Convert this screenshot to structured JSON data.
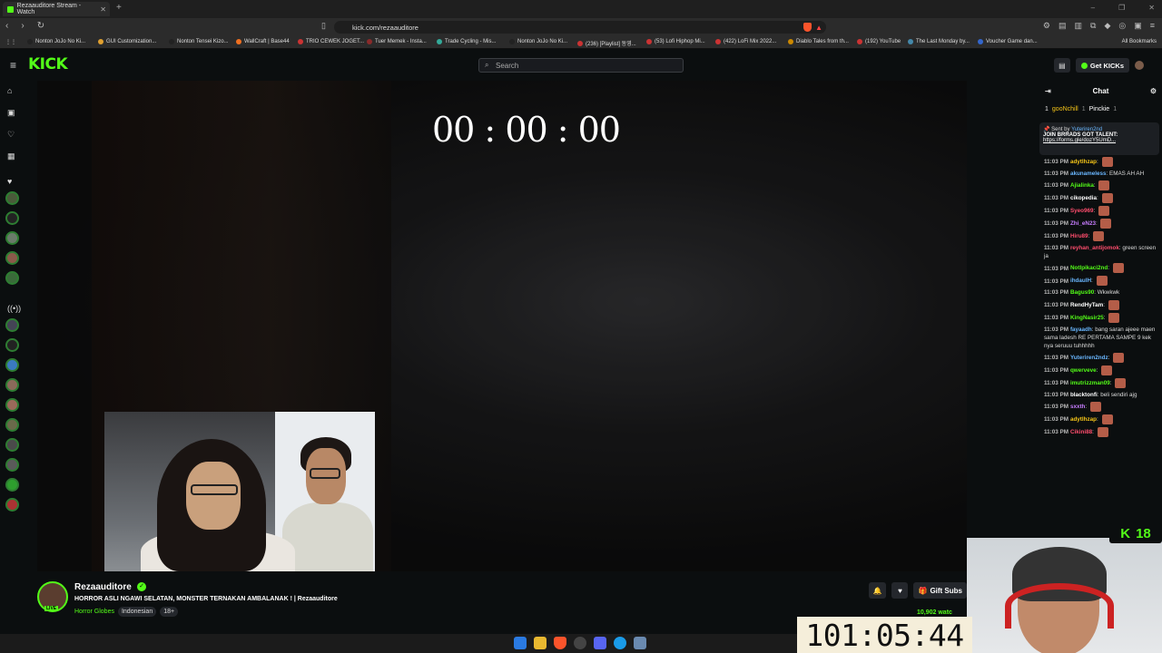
{
  "browser": {
    "tab_title": "Rezaauditore Stream - Watch",
    "url": "kick.com/rezaauditore",
    "bookmarks": [
      "Nonton JoJo No Ki...",
      "GUI Customization...",
      "Nonton Tensei Kizo...",
      "WallCraft | Base44",
      "TRIO CEWEK JOGET...",
      "Tuer Memek - Insta...",
      "Trade Cycling - Mis...",
      "Nonton JoJo No Ki...",
      "(236) [Playlist] 동영...",
      "(53) Lofi Hiphop Mi...",
      "(422) LoFi Mix 2022...",
      "Diablo Tales from th...",
      "(192) YouTube",
      "The Last Monday by...",
      "Voucher Game dan..."
    ],
    "all_bookmarks": "All Bookmarks"
  },
  "kick": {
    "logo": "KICK",
    "search_placeholder": "Search",
    "get_kicks": "Get KICKs"
  },
  "video": {
    "overlay_timer": "00 : 00 : 00"
  },
  "chat": {
    "title": "Chat",
    "leaderboard": {
      "rank": "1",
      "user1": "gooNchill",
      "user1_count": "1",
      "user2": "Pinckie",
      "user2_count": "1"
    },
    "pinned": {
      "sent_by": "Sent by",
      "sender": "Yuteriren2nd",
      "text": "JOIN BRRADS GOT TALENT:",
      "link": "https://forms.gle/dozY5UmD..."
    },
    "messages": [
      {
        "time": "11:03 PM",
        "user": "adytlhzap",
        "color": "#f5c518",
        "text": "",
        "emote": true
      },
      {
        "time": "11:03 PM",
        "user": "akunameless",
        "color": "#6ab7ff",
        "text": "EMAS AH AH",
        "emote": false
      },
      {
        "time": "11:03 PM",
        "user": "Ajialinka",
        "color": "#53fc18",
        "text": "",
        "emote": true
      },
      {
        "time": "11:03 PM",
        "user": "cikopedia",
        "color": "#ffffff",
        "text": "",
        "emote": true
      },
      {
        "time": "11:03 PM",
        "user": "Syeo969",
        "color": "#ff4d6d",
        "text": "",
        "emote": true
      },
      {
        "time": "11:03 PM",
        "user": "Zhi_eN23",
        "color": "#c77dff",
        "text": "",
        "emote": true
      },
      {
        "time": "11:03 PM",
        "user": "Hiru89",
        "color": "#ff4d6d",
        "text": "",
        "emote": true
      },
      {
        "time": "11:03 PM",
        "user": "reyhan_antijomok",
        "color": "#ff4d6d",
        "text": "green screen ja",
        "emote": false
      },
      {
        "time": "11:03 PM",
        "user": "Notlpikaci2nd",
        "color": "#53fc18",
        "text": "",
        "emote": true
      },
      {
        "time": "11:03 PM",
        "user": "ihdaulH",
        "color": "#6ab7ff",
        "text": "",
        "emote": true
      },
      {
        "time": "11:03 PM",
        "user": "Bagus90",
        "color": "#53fc18",
        "text": "Wkwkwk",
        "emote": false
      },
      {
        "time": "11:03 PM",
        "user": "RendHyTam",
        "color": "#ffffff",
        "text": "",
        "emote": true
      },
      {
        "time": "11:03 PM",
        "user": "KingNasir25",
        "color": "#53fc18",
        "text": "",
        "emote": true
      },
      {
        "time": "11:03 PM",
        "user": "fayaadh",
        "color": "#6ab7ff",
        "text": "bang saran ajeee maen sama ladesh RE PERTAMA SAMPE 9 kek nya seruuu tuhhhhh",
        "emote": false
      },
      {
        "time": "11:03 PM",
        "user": "Yuteriren2ndz",
        "color": "#6ab7ff",
        "text": "",
        "emote": true
      },
      {
        "time": "11:03 PM",
        "user": "qwerveve",
        "color": "#53fc18",
        "text": "",
        "emote": true
      },
      {
        "time": "11:03 PM",
        "user": "imutrizzman09",
        "color": "#53fc18",
        "text": "",
        "emote": true
      },
      {
        "time": "11:03 PM",
        "user": "blacktonfi",
        "color": "#ffffff",
        "text": "beli sendiri ajg",
        "emote": false
      },
      {
        "time": "11:03 PM",
        "user": "sxxth",
        "color": "#c77dff",
        "text": "",
        "emote": true
      },
      {
        "time": "11:03 PM",
        "user": "adytlhzap",
        "color": "#f5c518",
        "text": "",
        "emote": true
      },
      {
        "time": "11:03 PM",
        "user": "Cikini88",
        "color": "#ff4d6d",
        "text": "",
        "emote": true
      }
    ]
  },
  "channel": {
    "name": "Rezaauditore",
    "live_badge": "LIVE",
    "title": "HORROR ASLI NGAWI SELATAN, MONSTER TERNAKAN AMBALANAK ! | Rezaauditore",
    "category": "Horror Globes",
    "tags": [
      "Indonesian",
      "18+"
    ],
    "gift_subs": "Gift Subs",
    "viewers": "10,902 watc"
  },
  "overlays": {
    "kicks_count": "18",
    "countdown": "101:05:44"
  },
  "colors": {
    "accent": "#53fc18",
    "background": "#0b0e0f"
  }
}
